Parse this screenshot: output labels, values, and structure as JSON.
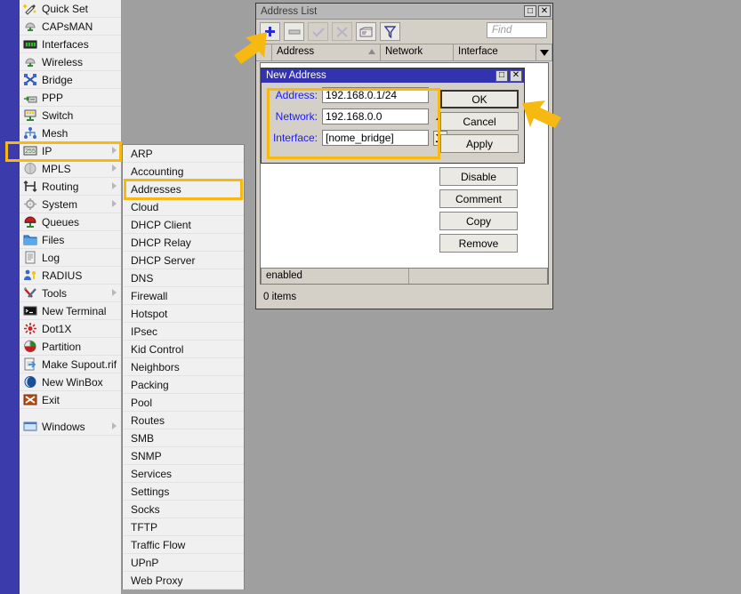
{
  "app": {
    "sidebar_items": [
      {
        "label": "Quick Set",
        "icon": "wand-icon",
        "arrow": false
      },
      {
        "label": "CAPsMAN",
        "icon": "capsman-icon",
        "arrow": false
      },
      {
        "label": "Interfaces",
        "icon": "interfaces-icon",
        "arrow": false
      },
      {
        "label": "Wireless",
        "icon": "wireless-icon",
        "arrow": false
      },
      {
        "label": "Bridge",
        "icon": "bridge-icon",
        "arrow": false
      },
      {
        "label": "PPP",
        "icon": "ppp-icon",
        "arrow": false
      },
      {
        "label": "Switch",
        "icon": "switch-icon",
        "arrow": false
      },
      {
        "label": "Mesh",
        "icon": "mesh-icon",
        "arrow": false
      },
      {
        "label": "IP",
        "icon": "ip-icon",
        "arrow": true,
        "highlighted": true
      },
      {
        "label": "MPLS",
        "icon": "mpls-icon",
        "arrow": true
      },
      {
        "label": "Routing",
        "icon": "routing-icon",
        "arrow": true
      },
      {
        "label": "System",
        "icon": "system-icon",
        "arrow": true
      },
      {
        "label": "Queues",
        "icon": "queues-icon",
        "arrow": false
      },
      {
        "label": "Files",
        "icon": "files-icon",
        "arrow": false
      },
      {
        "label": "Log",
        "icon": "log-icon",
        "arrow": false
      },
      {
        "label": "RADIUS",
        "icon": "radius-icon",
        "arrow": false
      },
      {
        "label": "Tools",
        "icon": "tools-icon",
        "arrow": true
      },
      {
        "label": "New Terminal",
        "icon": "terminal-icon",
        "arrow": false
      },
      {
        "label": "Dot1X",
        "icon": "dot1x-icon",
        "arrow": false
      },
      {
        "label": "Partition",
        "icon": "partition-icon",
        "arrow": false
      },
      {
        "label": "Make Supout.rif",
        "icon": "supout-icon",
        "arrow": false
      },
      {
        "label": "New WinBox",
        "icon": "winbox-icon",
        "arrow": false
      },
      {
        "label": "Exit",
        "icon": "exit-icon",
        "arrow": false
      },
      {
        "label": "",
        "icon": "spacer",
        "arrow": false,
        "spacer": true
      },
      {
        "label": "Windows",
        "icon": "windows-icon",
        "arrow": true
      }
    ],
    "ip_submenu": [
      {
        "label": "ARP"
      },
      {
        "label": "Accounting"
      },
      {
        "label": "Addresses",
        "highlighted": true
      },
      {
        "label": "Cloud"
      },
      {
        "label": "DHCP Client"
      },
      {
        "label": "DHCP Relay"
      },
      {
        "label": "DHCP Server"
      },
      {
        "label": "DNS"
      },
      {
        "label": "Firewall"
      },
      {
        "label": "Hotspot"
      },
      {
        "label": "IPsec"
      },
      {
        "label": "Kid Control"
      },
      {
        "label": "Neighbors"
      },
      {
        "label": "Packing"
      },
      {
        "label": "Pool"
      },
      {
        "label": "Routes"
      },
      {
        "label": "SMB"
      },
      {
        "label": "SNMP"
      },
      {
        "label": "Services"
      },
      {
        "label": "Settings"
      },
      {
        "label": "Socks"
      },
      {
        "label": "TFTP"
      },
      {
        "label": "Traffic Flow"
      },
      {
        "label": "UPnP"
      },
      {
        "label": "Web Proxy"
      }
    ]
  },
  "address_list_window": {
    "title": "Address List",
    "maximize_label": "□",
    "close_label": "✕",
    "toolbar": {
      "add_label": "+",
      "remove_label": "—",
      "enable_label": "✓",
      "disable_label": "✕",
      "comment_label": "⌷",
      "filter_label": "▽"
    },
    "find": {
      "value": "",
      "placeholder": "Find"
    },
    "columns": [
      "Address",
      "Network",
      "Interface"
    ],
    "sort_indicator": "△",
    "dropdown_label": "▼",
    "status_left": "enabled",
    "status_right": "",
    "items_count": "0 items"
  },
  "new_address_dialog": {
    "title": "New Address",
    "maximize_label": "□",
    "close_label": "✕",
    "fields": [
      {
        "label": "Address:",
        "value": "192.168.0.1/24",
        "spinner": "none"
      },
      {
        "label": "Network:",
        "value": "192.168.0.0",
        "spinner": "up"
      },
      {
        "label": "Interface:",
        "value": "[nome_bridge]",
        "spinner": "down-bar"
      }
    ],
    "buttons_top": [
      "OK",
      "Cancel",
      "Apply"
    ],
    "buttons_bottom": [
      "Disable",
      "Comment",
      "Copy",
      "Remove"
    ]
  },
  "annotations": {
    "highlight_color": "#f5b912",
    "arrow_add_button": "arrow pointing to add (+) toolbar button",
    "arrow_ok_button": "arrow pointing to OK button"
  }
}
